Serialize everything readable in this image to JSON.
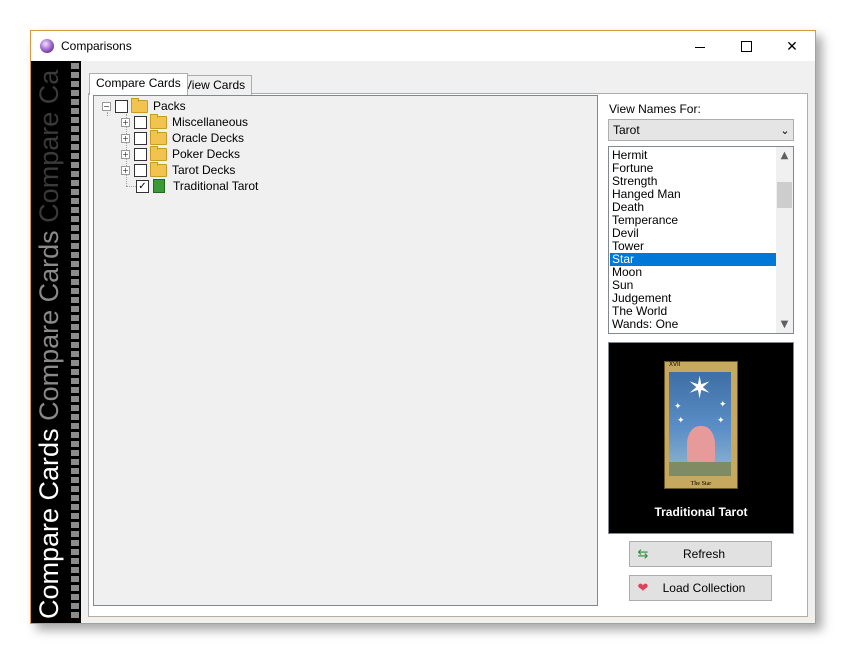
{
  "window": {
    "title": "Comparisons"
  },
  "titlebar_buttons": {
    "minimize": "—",
    "maximize": "☐",
    "close": "✕"
  },
  "sidebar": {
    "text_primary": "Compare Cards",
    "text_secondary": "Compare Cards",
    "text_tertiary": "Compare Ca"
  },
  "tabs": [
    {
      "label": "Compare Cards",
      "active": true
    },
    {
      "label": "View Cards",
      "active": false
    }
  ],
  "tree": {
    "root": {
      "label": "Packs",
      "expand": "−",
      "checked": false
    },
    "children": [
      {
        "label": "Miscellaneous",
        "expand": "+",
        "checked": false
      },
      {
        "label": "Oracle Decks",
        "expand": "+",
        "checked": false
      },
      {
        "label": "Poker Decks",
        "expand": "+",
        "checked": false
      },
      {
        "label": "Tarot Decks",
        "expand": "+",
        "checked": false
      },
      {
        "label": "Traditional Tarot",
        "checked": true,
        "check_glyph": "✓"
      }
    ]
  },
  "view_names": {
    "label": "View Names For:",
    "selected": "Tarot",
    "chevron": "⌵"
  },
  "names_list": {
    "items": [
      "Hermit",
      "Fortune",
      "Strength",
      "Hanged Man",
      "Death",
      "Temperance",
      "Devil",
      "Tower",
      "Star",
      "Moon",
      "Sun",
      "Judgement",
      "The World",
      "Wands: One"
    ],
    "selected_index": 8,
    "scroll_up": "⌃",
    "scroll_down": "⌄"
  },
  "preview": {
    "card_number": "XVII",
    "card_title": "The Star",
    "deck_label": "Traditional Tarot"
  },
  "buttons": {
    "refresh": {
      "label": "Refresh",
      "icon": "refresh-icon",
      "glyph": "⇆",
      "color": "#2e8b3a"
    },
    "load_collection": {
      "label": "Load Collection",
      "icon": "heart-icon",
      "glyph": "❤",
      "color": "#e0405a"
    }
  },
  "colors": {
    "selection": "#0078d7",
    "window_border": "#d79a3a"
  }
}
